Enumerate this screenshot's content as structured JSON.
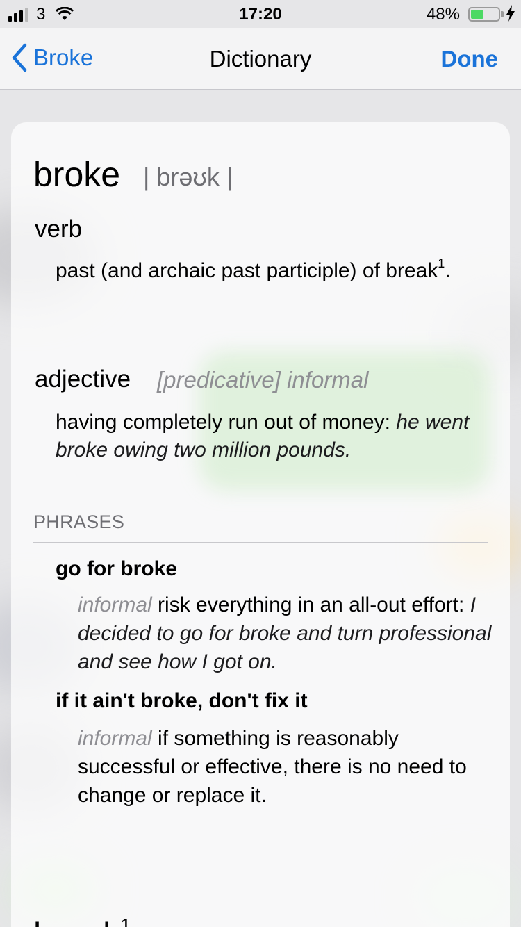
{
  "status_bar": {
    "carrier": "3",
    "time": "17:20",
    "battery_percent": "48%",
    "battery_level": 0.48
  },
  "nav": {
    "back_label": "Broke",
    "title": "Dictionary",
    "done_label": "Done"
  },
  "entry": {
    "headword": "broke",
    "pronunciation": "| brəʊk |",
    "senses": [
      {
        "pos": "verb",
        "definition_text": "past (and archaic past participle) of",
        "cross_ref": "break",
        "cross_ref_sup": "1",
        "end_punct": "."
      },
      {
        "pos": "adjective",
        "labels": "[predicative] informal",
        "definition_text": "having completely run out of money:",
        "example": "he went broke owing two million pounds."
      }
    ],
    "phrases_heading": "PHRASES",
    "phrases": [
      {
        "phrase": "go for broke",
        "register": "informal",
        "definition_text": "risk everything in an all-out effort:",
        "example": "I decided to go for broke and turn professional and see how I got on."
      },
      {
        "phrase": "if it ain't broke, don't fix it",
        "register": "informal",
        "definition_text": "if something is reasonably successful or effective, there is no need to change or replace it."
      }
    ],
    "next_headword": "break",
    "next_headword_sup": "1"
  }
}
